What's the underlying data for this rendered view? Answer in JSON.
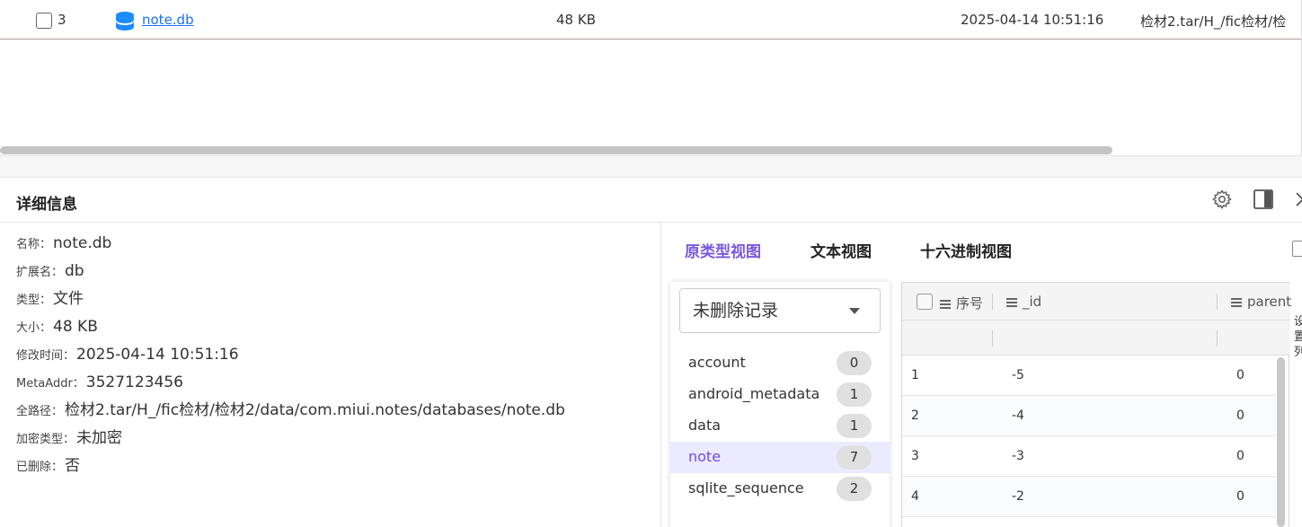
{
  "file_row": {
    "index": "3",
    "name": "note.db",
    "size": "48 KB",
    "modified": "2025-04-14 10:51:16",
    "path": "检材2.tar/H_/fic检材/检"
  },
  "detail": {
    "title": "详细信息",
    "props": [
      {
        "key": "名称：",
        "value": "note.db"
      },
      {
        "key": "扩展名：",
        "value": "db"
      },
      {
        "key": "类型：",
        "value": "文件"
      },
      {
        "key": "大小：",
        "value": "48 KB"
      },
      {
        "key": "修改时间：",
        "value": "2025-04-14 10:51:16"
      },
      {
        "key": "MetaAddr：",
        "value": "3527123456"
      },
      {
        "key": "全路径：",
        "value": "检材2.tar/H_/fic检材/检材2/data/com.miui.notes/databases/note.db"
      },
      {
        "key": "加密类型：",
        "value": "未加密"
      },
      {
        "key": "已删除：",
        "value": "否"
      }
    ]
  },
  "tabs": [
    "原类型视图",
    "文本视图",
    "十六进制视图"
  ],
  "active_tab": 0,
  "record_filter": "未删除记录",
  "tables": [
    {
      "name": "account",
      "count": "0"
    },
    {
      "name": "android_metadata",
      "count": "1"
    },
    {
      "name": "data",
      "count": "1"
    },
    {
      "name": "note",
      "count": "7"
    },
    {
      "name": "sqlite_sequence",
      "count": "2"
    }
  ],
  "selected_table": 3,
  "grid": {
    "columns": [
      "序号",
      "_id",
      "parent"
    ],
    "rows": [
      [
        "1",
        "-5",
        "0"
      ],
      [
        "2",
        "-4",
        "0"
      ],
      [
        "3",
        "-3",
        "0"
      ],
      [
        "4",
        "-2",
        "0"
      ]
    ]
  },
  "side_text": "设置列",
  "colors": {
    "accent": "#7b57e0",
    "link": "#1a73e8",
    "selected_bg": "#eceaff"
  }
}
